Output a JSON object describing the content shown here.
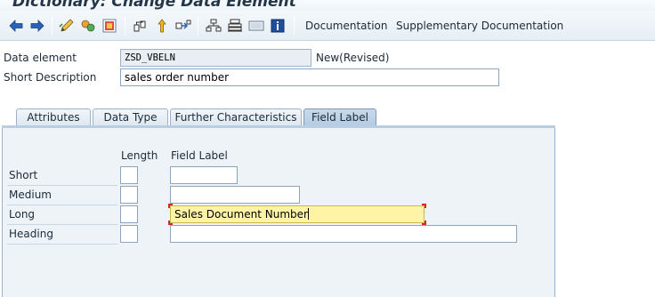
{
  "title": "Dictionary: Change Data Element",
  "toolbar": {
    "icons": [
      "back-icon",
      "forward-icon",
      "display-change-icon",
      "other-object-icon",
      "activate-icon",
      "check-icon",
      "where-used-icon",
      "hierarchy-icon",
      "print-icon",
      "display-object-list-icon",
      "info-icon"
    ],
    "documentation_label": "Documentation",
    "supplementary_label": "Supplementary Documentation"
  },
  "header": {
    "data_element_label": "Data element",
    "data_element_value": "ZSD_VBELN",
    "status": "New(Revised)",
    "short_desc_label": "Short Description",
    "short_desc_value": "sales order number"
  },
  "tabs": [
    {
      "label": "Attributes",
      "active": false
    },
    {
      "label": "Data Type",
      "active": false
    },
    {
      "label": "Further Characteristics",
      "active": false
    },
    {
      "label": "Field Label",
      "active": true
    }
  ],
  "field_label": {
    "col_length": "Length",
    "col_field_label": "Field Label",
    "rows": [
      {
        "label": "Short",
        "length": "",
        "text": ""
      },
      {
        "label": "Medium",
        "length": "",
        "text": ""
      },
      {
        "label": "Long",
        "length": "",
        "text": "Sales Document Number"
      },
      {
        "label": "Heading",
        "length": "",
        "text": ""
      }
    ]
  },
  "colors": {
    "focus_field": "#fff4a6",
    "focus_marker": "#d2281e",
    "active_tab": "#b3cbe2"
  }
}
